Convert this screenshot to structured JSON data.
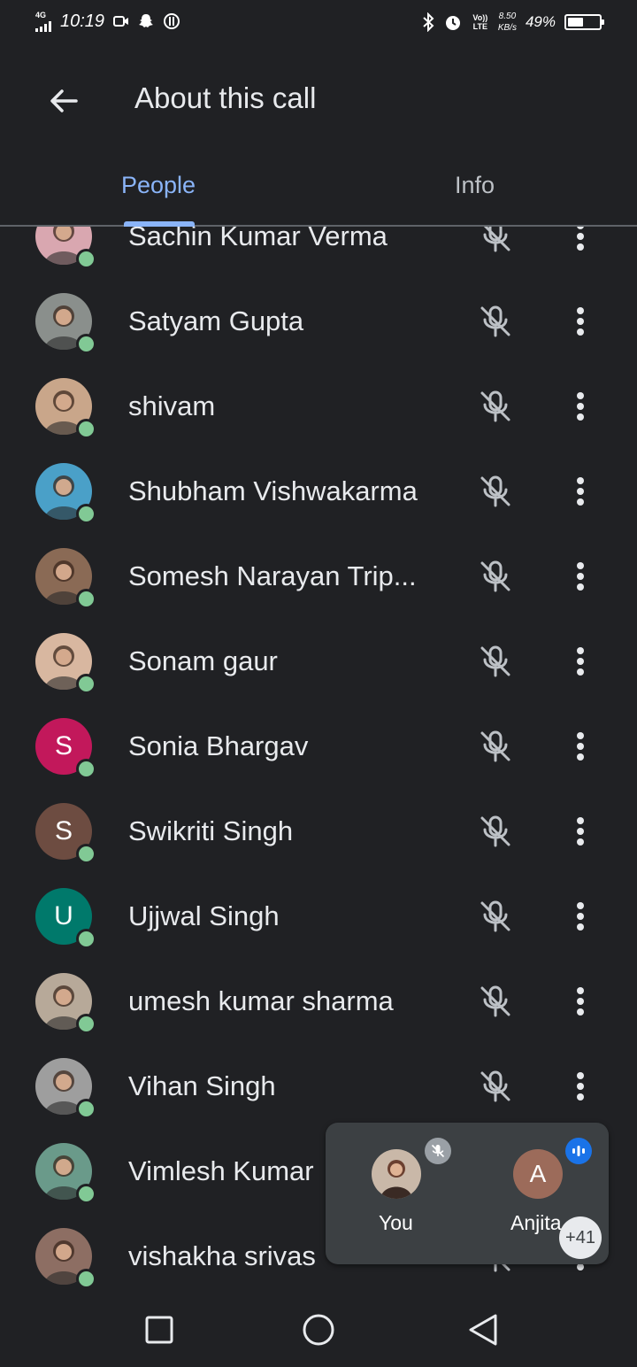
{
  "status_bar": {
    "network": "4G",
    "time": "10:19",
    "volte": "Vo)) LTE",
    "speed_value": "8.50",
    "speed_unit": "KB/s",
    "battery": "49%",
    "battery_level": 0.49,
    "icons": [
      "signal-icon",
      "video-icon",
      "snapchat-icon",
      "data-saver-icon",
      "bluetooth-icon",
      "alarm-icon"
    ]
  },
  "header": {
    "title": "About this call",
    "back_icon": "arrow-left-icon"
  },
  "tabs": [
    {
      "label": "People",
      "selected": true
    },
    {
      "label": "Info",
      "selected": false
    }
  ],
  "accent_color": "#8ab4f8",
  "participants": [
    {
      "name": "Sachin Kumar Verma",
      "initial": "",
      "avatar_color": "#d9a7b0",
      "photo": true
    },
    {
      "name": "Satyam Gupta",
      "initial": "",
      "avatar_color": "#8a8f8c",
      "photo": true
    },
    {
      "name": "shivam",
      "initial": "",
      "avatar_color": "#c9a68a",
      "photo": true
    },
    {
      "name": "Shubham Vishwakarma",
      "initial": "",
      "avatar_color": "#4aa0c8",
      "photo": true
    },
    {
      "name": "Somesh Narayan Trip...",
      "initial": "",
      "avatar_color": "#8a6a55",
      "photo": true
    },
    {
      "name": "Sonam gaur",
      "initial": "",
      "avatar_color": "#d8b7a0",
      "photo": true
    },
    {
      "name": "Sonia Bhargav",
      "initial": "S",
      "avatar_color": "#c2185b",
      "photo": false
    },
    {
      "name": "Swikriti Singh",
      "initial": "S",
      "avatar_color": "#6d4c41",
      "photo": false
    },
    {
      "name": "Ujjwal Singh",
      "initial": "U",
      "avatar_color": "#00796b",
      "photo": false
    },
    {
      "name": "umesh kumar sharma",
      "initial": "",
      "avatar_color": "#b7a999",
      "photo": true
    },
    {
      "name": "Vihan Singh",
      "initial": "",
      "avatar_color": "#9e9e9e",
      "photo": true
    },
    {
      "name": "Vimlesh Kumar",
      "initial": "",
      "avatar_color": "#6a9a8a",
      "photo": true
    },
    {
      "name": "vishakha srivas",
      "initial": "",
      "avatar_color": "#8d6e63",
      "photo": true
    }
  ],
  "self_view": {
    "you_label": "You",
    "you_muted": true,
    "other_label": "Anjita",
    "other_initial": "A",
    "other_avatar_color": "#9c6b5a",
    "other_speaking": true,
    "more_count": "+41"
  },
  "nav_bar": [
    "recents-square-icon",
    "home-circle-icon",
    "back-triangle-icon"
  ]
}
